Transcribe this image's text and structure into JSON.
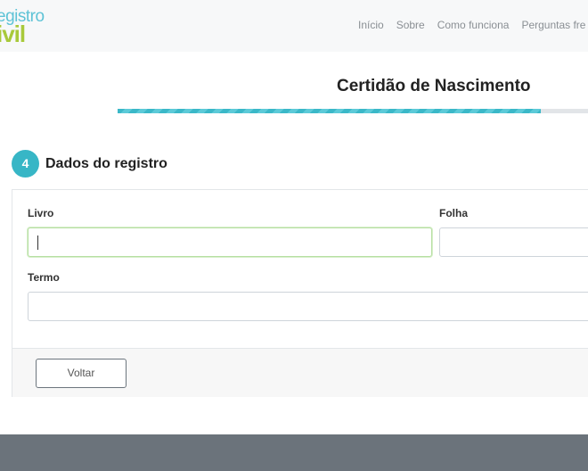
{
  "header": {
    "logo_top": "egistro",
    "logo_bottom": "ivil",
    "nav": [
      {
        "id": "inicio",
        "label": "Início"
      },
      {
        "id": "sobre",
        "label": "Sobre"
      },
      {
        "id": "como-funciona",
        "label": "Como funciona"
      },
      {
        "id": "perguntas",
        "label": "Perguntas fre"
      }
    ]
  },
  "page": {
    "title": "Certidão de Nascimento",
    "progress_fraction": 0.88
  },
  "step": {
    "number": "4",
    "title": "Dados do registro"
  },
  "form": {
    "livro": {
      "label": "Livro",
      "value": ""
    },
    "folha": {
      "label": "Folha",
      "value": ""
    },
    "termo": {
      "label": "Termo",
      "value": ""
    },
    "back_label": "Voltar"
  },
  "colors": {
    "accent": "#37b6c6",
    "logo_green": "#a8c93a",
    "footer": "#6b737b"
  }
}
